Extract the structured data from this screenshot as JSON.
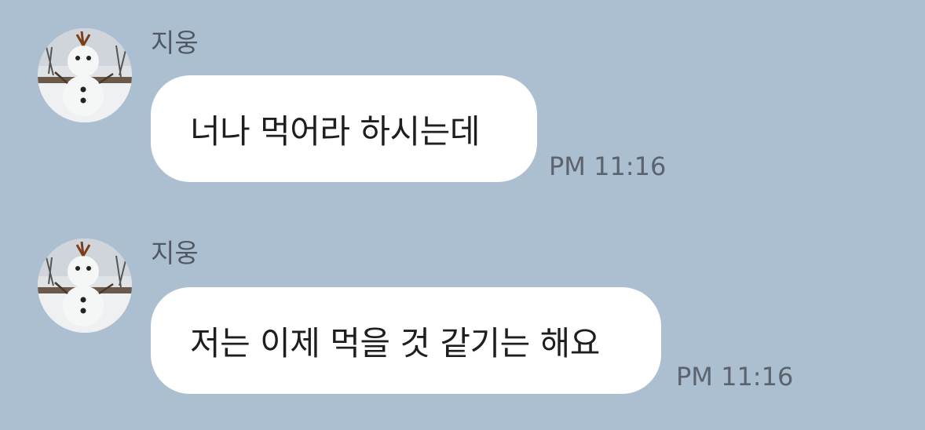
{
  "messages": [
    {
      "sender": "지웅",
      "text": "너나 먹어라 하시는데",
      "time": "PM 11:16",
      "avatar_icon": "snowman-avatar-icon"
    },
    {
      "sender": "지웅",
      "text": "저는 이제 먹을 것 같기는 해요",
      "time": "PM 11:16",
      "avatar_icon": "snowman-avatar-icon"
    }
  ],
  "colors": {
    "background": "#acbfd0",
    "bubble": "#ffffff",
    "sender_text": "#4f5863",
    "time_text": "#5a636e",
    "message_text": "#1e1e1e"
  }
}
